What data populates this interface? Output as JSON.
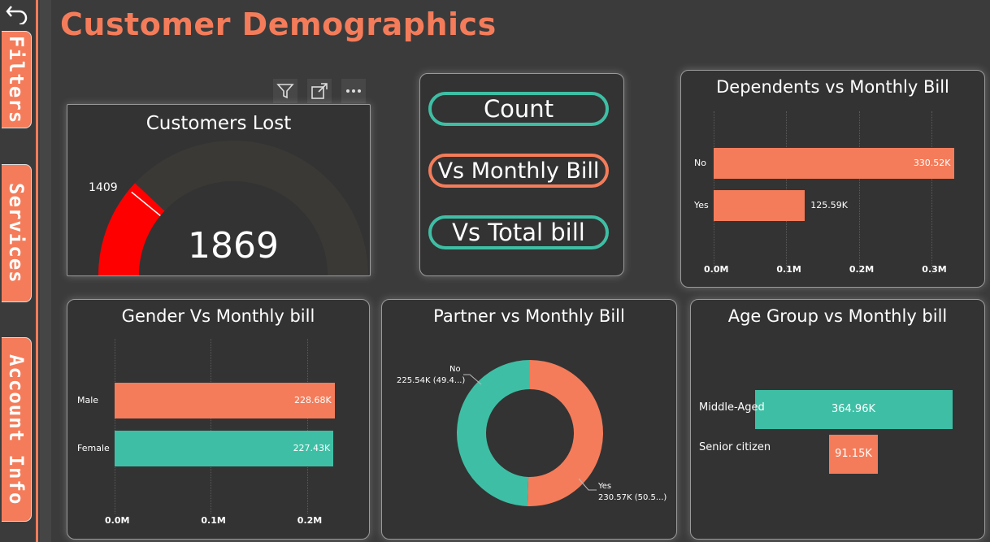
{
  "page": {
    "title": "Customer Demographics"
  },
  "rail": {
    "tabs": [
      "Filters",
      "Services",
      "Account Info"
    ],
    "accent": "#f47c5a"
  },
  "colors": {
    "coral": "#f47c5a",
    "teal": "#3ebfa5",
    "red": "#ff0000",
    "background": "#3b3b3b",
    "card": "#333333"
  },
  "gauge": {
    "title": "Customers Lost",
    "value_label": "1869",
    "target_label": "1409"
  },
  "buttons": {
    "count": "Count",
    "monthly": "Vs Monthly Bill",
    "total": "Vs Total bill"
  },
  "dependents": {
    "title": "Dependents vs Monthly Bill",
    "categories": [
      "No",
      "Yes"
    ],
    "value_labels": [
      "330.52K",
      "125.59K"
    ],
    "ticks": [
      "0.0M",
      "0.1M",
      "0.2M",
      "0.3M"
    ]
  },
  "gender": {
    "title": "Gender Vs Monthly bill",
    "categories": [
      "Male",
      "Female"
    ],
    "value_labels": [
      "228.68K",
      "227.43K"
    ],
    "ticks": [
      "0.0M",
      "0.1M",
      "0.2M"
    ]
  },
  "partner": {
    "title": "Partner vs Monthly Bill",
    "no_label": "No",
    "no_value": "225.54K (49.4...)",
    "yes_label": "Yes",
    "yes_value": "230.57K (50.5...)"
  },
  "age": {
    "title": "Age Group vs Monthly bill",
    "categories": [
      "Middle-Aged",
      "Senior citizen"
    ],
    "value_labels": [
      "364.96K",
      "91.15K"
    ]
  },
  "chart_data": [
    {
      "type": "gauge",
      "title": "Customers Lost",
      "value": 1869,
      "target": 1409
    },
    {
      "type": "bar",
      "title": "Dependents vs Monthly Bill",
      "categories": [
        "No",
        "Yes"
      ],
      "values": [
        330520,
        125590
      ],
      "xlim": [
        0,
        0.33
      ],
      "xticks": [
        "0.0M",
        "0.1M",
        "0.2M",
        "0.3M"
      ]
    },
    {
      "type": "bar",
      "title": "Gender Vs Monthly bill",
      "categories": [
        "Male",
        "Female"
      ],
      "values": [
        228680,
        227430
      ],
      "xticks": [
        "0.0M",
        "0.1M",
        "0.2M"
      ]
    },
    {
      "type": "pie",
      "title": "Partner vs Monthly Bill",
      "categories": [
        "No",
        "Yes"
      ],
      "values": [
        225540,
        230570
      ]
    },
    {
      "type": "bar",
      "title": "Age Group vs Monthly bill",
      "categories": [
        "Middle-Aged",
        "Senior citizen"
      ],
      "values": [
        364960,
        91150
      ]
    }
  ]
}
